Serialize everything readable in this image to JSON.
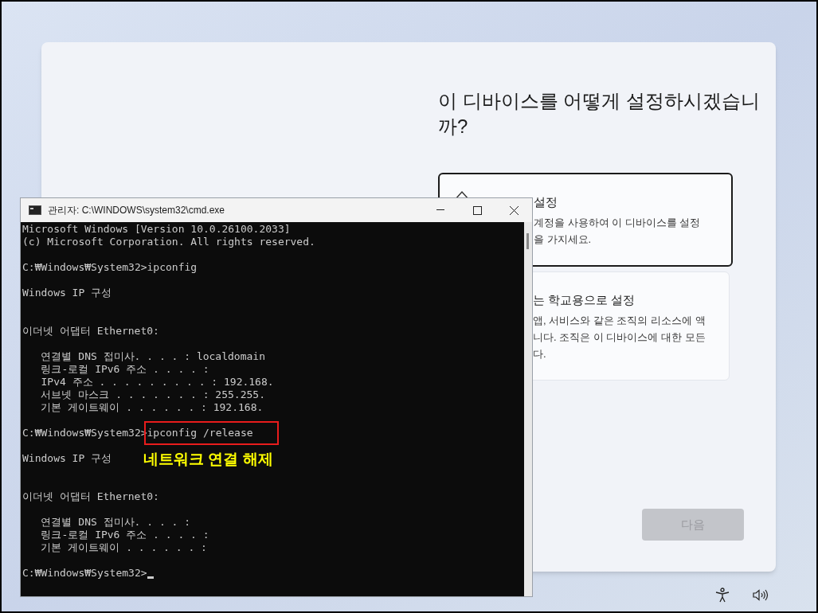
{
  "setup": {
    "title": "이 디바이스를 어떻게 설정하시겠습니까?",
    "options": [
      {
        "title": "설정",
        "lines": [
          "계정을 사용하여 이 디바이스를 설정",
          "을 가지세요."
        ],
        "selected": true
      },
      {
        "title": "는 학교용으로 설정",
        "lines": [
          "앱, 서비스와 같은 조직의 리소스에 액",
          "니다. 조직은 이 디바이스에 대한 모든",
          "다."
        ],
        "selected": false
      }
    ],
    "next_button": {
      "label": "다음",
      "disabled": true
    }
  },
  "console": {
    "title": "관리자: C:\\WINDOWS\\system32\\cmd.exe",
    "lines": [
      {
        "kind": "text",
        "text": "Microsoft Windows [Version 10.0.26100.2033]"
      },
      {
        "kind": "text",
        "text": "(c) Microsoft Corporation. All rights reserved."
      },
      {
        "kind": "blank"
      },
      {
        "kind": "command",
        "prompt": "C:₩Windows₩System32>",
        "command": "ipconfig",
        "highlighted": false
      },
      {
        "kind": "blank"
      },
      {
        "kind": "text",
        "text": "Windows IP 구성"
      },
      {
        "kind": "blank"
      },
      {
        "kind": "blank"
      },
      {
        "kind": "text",
        "text": "이더넷 어댑터 Ethernet0:"
      },
      {
        "kind": "blank"
      },
      {
        "kind": "text",
        "text": "   연결별 DNS 접미사. . . . : localdomain"
      },
      {
        "kind": "text",
        "text": "   링크-로컬 IPv6 주소 . . . . :"
      },
      {
        "kind": "text",
        "text": "   IPv4 주소 . . . . . . . . . : 192.168."
      },
      {
        "kind": "text",
        "text": "   서브넷 마스크 . . . . . . . : 255.255."
      },
      {
        "kind": "text",
        "text": "   기본 게이트웨이 . . . . . . : 192.168."
      },
      {
        "kind": "blank"
      },
      {
        "kind": "command",
        "prompt": "C:₩Windows₩System32>",
        "command": "ipconfig /release",
        "highlighted": true
      },
      {
        "kind": "blank"
      },
      {
        "kind": "text",
        "text": "Windows IP 구성"
      },
      {
        "kind": "blank"
      },
      {
        "kind": "blank"
      },
      {
        "kind": "text",
        "text": "이더넷 어댑터 Ethernet0:"
      },
      {
        "kind": "blank"
      },
      {
        "kind": "text",
        "text": "   연결별 DNS 접미사. . . . :"
      },
      {
        "kind": "text",
        "text": "   링크-로컬 IPv6 주소 . . . . :"
      },
      {
        "kind": "text",
        "text": "   기본 게이트웨이 . . . . . . :"
      },
      {
        "kind": "blank"
      },
      {
        "kind": "prompt",
        "prompt": "C:₩Windows₩System32>",
        "cursor": true
      }
    ],
    "annotation": "네트워크 연결 해제"
  }
}
